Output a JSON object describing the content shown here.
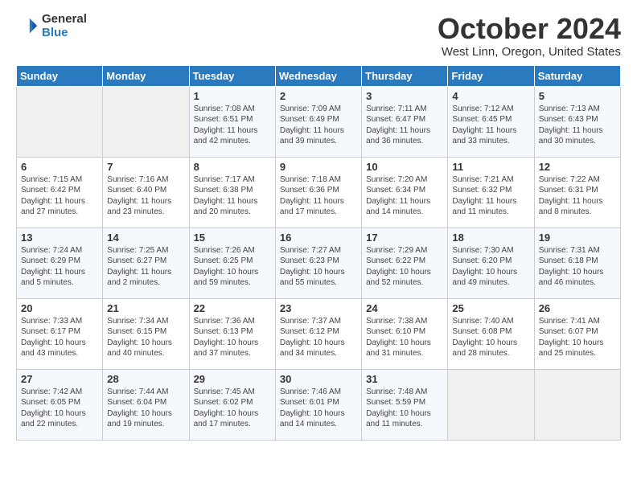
{
  "logo": {
    "general": "General",
    "blue": "Blue"
  },
  "title": "October 2024",
  "location": "West Linn, Oregon, United States",
  "days_of_week": [
    "Sunday",
    "Monday",
    "Tuesday",
    "Wednesday",
    "Thursday",
    "Friday",
    "Saturday"
  ],
  "weeks": [
    [
      {
        "day": "",
        "sunrise": "",
        "sunset": "",
        "daylight": ""
      },
      {
        "day": "",
        "sunrise": "",
        "sunset": "",
        "daylight": ""
      },
      {
        "day": "1",
        "sunrise": "Sunrise: 7:08 AM",
        "sunset": "Sunset: 6:51 PM",
        "daylight": "Daylight: 11 hours and 42 minutes."
      },
      {
        "day": "2",
        "sunrise": "Sunrise: 7:09 AM",
        "sunset": "Sunset: 6:49 PM",
        "daylight": "Daylight: 11 hours and 39 minutes."
      },
      {
        "day": "3",
        "sunrise": "Sunrise: 7:11 AM",
        "sunset": "Sunset: 6:47 PM",
        "daylight": "Daylight: 11 hours and 36 minutes."
      },
      {
        "day": "4",
        "sunrise": "Sunrise: 7:12 AM",
        "sunset": "Sunset: 6:45 PM",
        "daylight": "Daylight: 11 hours and 33 minutes."
      },
      {
        "day": "5",
        "sunrise": "Sunrise: 7:13 AM",
        "sunset": "Sunset: 6:43 PM",
        "daylight": "Daylight: 11 hours and 30 minutes."
      }
    ],
    [
      {
        "day": "6",
        "sunrise": "Sunrise: 7:15 AM",
        "sunset": "Sunset: 6:42 PM",
        "daylight": "Daylight: 11 hours and 27 minutes."
      },
      {
        "day": "7",
        "sunrise": "Sunrise: 7:16 AM",
        "sunset": "Sunset: 6:40 PM",
        "daylight": "Daylight: 11 hours and 23 minutes."
      },
      {
        "day": "8",
        "sunrise": "Sunrise: 7:17 AM",
        "sunset": "Sunset: 6:38 PM",
        "daylight": "Daylight: 11 hours and 20 minutes."
      },
      {
        "day": "9",
        "sunrise": "Sunrise: 7:18 AM",
        "sunset": "Sunset: 6:36 PM",
        "daylight": "Daylight: 11 hours and 17 minutes."
      },
      {
        "day": "10",
        "sunrise": "Sunrise: 7:20 AM",
        "sunset": "Sunset: 6:34 PM",
        "daylight": "Daylight: 11 hours and 14 minutes."
      },
      {
        "day": "11",
        "sunrise": "Sunrise: 7:21 AM",
        "sunset": "Sunset: 6:32 PM",
        "daylight": "Daylight: 11 hours and 11 minutes."
      },
      {
        "day": "12",
        "sunrise": "Sunrise: 7:22 AM",
        "sunset": "Sunset: 6:31 PM",
        "daylight": "Daylight: 11 hours and 8 minutes."
      }
    ],
    [
      {
        "day": "13",
        "sunrise": "Sunrise: 7:24 AM",
        "sunset": "Sunset: 6:29 PM",
        "daylight": "Daylight: 11 hours and 5 minutes."
      },
      {
        "day": "14",
        "sunrise": "Sunrise: 7:25 AM",
        "sunset": "Sunset: 6:27 PM",
        "daylight": "Daylight: 11 hours and 2 minutes."
      },
      {
        "day": "15",
        "sunrise": "Sunrise: 7:26 AM",
        "sunset": "Sunset: 6:25 PM",
        "daylight": "Daylight: 10 hours and 59 minutes."
      },
      {
        "day": "16",
        "sunrise": "Sunrise: 7:27 AM",
        "sunset": "Sunset: 6:23 PM",
        "daylight": "Daylight: 10 hours and 55 minutes."
      },
      {
        "day": "17",
        "sunrise": "Sunrise: 7:29 AM",
        "sunset": "Sunset: 6:22 PM",
        "daylight": "Daylight: 10 hours and 52 minutes."
      },
      {
        "day": "18",
        "sunrise": "Sunrise: 7:30 AM",
        "sunset": "Sunset: 6:20 PM",
        "daylight": "Daylight: 10 hours and 49 minutes."
      },
      {
        "day": "19",
        "sunrise": "Sunrise: 7:31 AM",
        "sunset": "Sunset: 6:18 PM",
        "daylight": "Daylight: 10 hours and 46 minutes."
      }
    ],
    [
      {
        "day": "20",
        "sunrise": "Sunrise: 7:33 AM",
        "sunset": "Sunset: 6:17 PM",
        "daylight": "Daylight: 10 hours and 43 minutes."
      },
      {
        "day": "21",
        "sunrise": "Sunrise: 7:34 AM",
        "sunset": "Sunset: 6:15 PM",
        "daylight": "Daylight: 10 hours and 40 minutes."
      },
      {
        "day": "22",
        "sunrise": "Sunrise: 7:36 AM",
        "sunset": "Sunset: 6:13 PM",
        "daylight": "Daylight: 10 hours and 37 minutes."
      },
      {
        "day": "23",
        "sunrise": "Sunrise: 7:37 AM",
        "sunset": "Sunset: 6:12 PM",
        "daylight": "Daylight: 10 hours and 34 minutes."
      },
      {
        "day": "24",
        "sunrise": "Sunrise: 7:38 AM",
        "sunset": "Sunset: 6:10 PM",
        "daylight": "Daylight: 10 hours and 31 minutes."
      },
      {
        "day": "25",
        "sunrise": "Sunrise: 7:40 AM",
        "sunset": "Sunset: 6:08 PM",
        "daylight": "Daylight: 10 hours and 28 minutes."
      },
      {
        "day": "26",
        "sunrise": "Sunrise: 7:41 AM",
        "sunset": "Sunset: 6:07 PM",
        "daylight": "Daylight: 10 hours and 25 minutes."
      }
    ],
    [
      {
        "day": "27",
        "sunrise": "Sunrise: 7:42 AM",
        "sunset": "Sunset: 6:05 PM",
        "daylight": "Daylight: 10 hours and 22 minutes."
      },
      {
        "day": "28",
        "sunrise": "Sunrise: 7:44 AM",
        "sunset": "Sunset: 6:04 PM",
        "daylight": "Daylight: 10 hours and 19 minutes."
      },
      {
        "day": "29",
        "sunrise": "Sunrise: 7:45 AM",
        "sunset": "Sunset: 6:02 PM",
        "daylight": "Daylight: 10 hours and 17 minutes."
      },
      {
        "day": "30",
        "sunrise": "Sunrise: 7:46 AM",
        "sunset": "Sunset: 6:01 PM",
        "daylight": "Daylight: 10 hours and 14 minutes."
      },
      {
        "day": "31",
        "sunrise": "Sunrise: 7:48 AM",
        "sunset": "Sunset: 5:59 PM",
        "daylight": "Daylight: 10 hours and 11 minutes."
      },
      {
        "day": "",
        "sunrise": "",
        "sunset": "",
        "daylight": ""
      },
      {
        "day": "",
        "sunrise": "",
        "sunset": "",
        "daylight": ""
      }
    ]
  ]
}
